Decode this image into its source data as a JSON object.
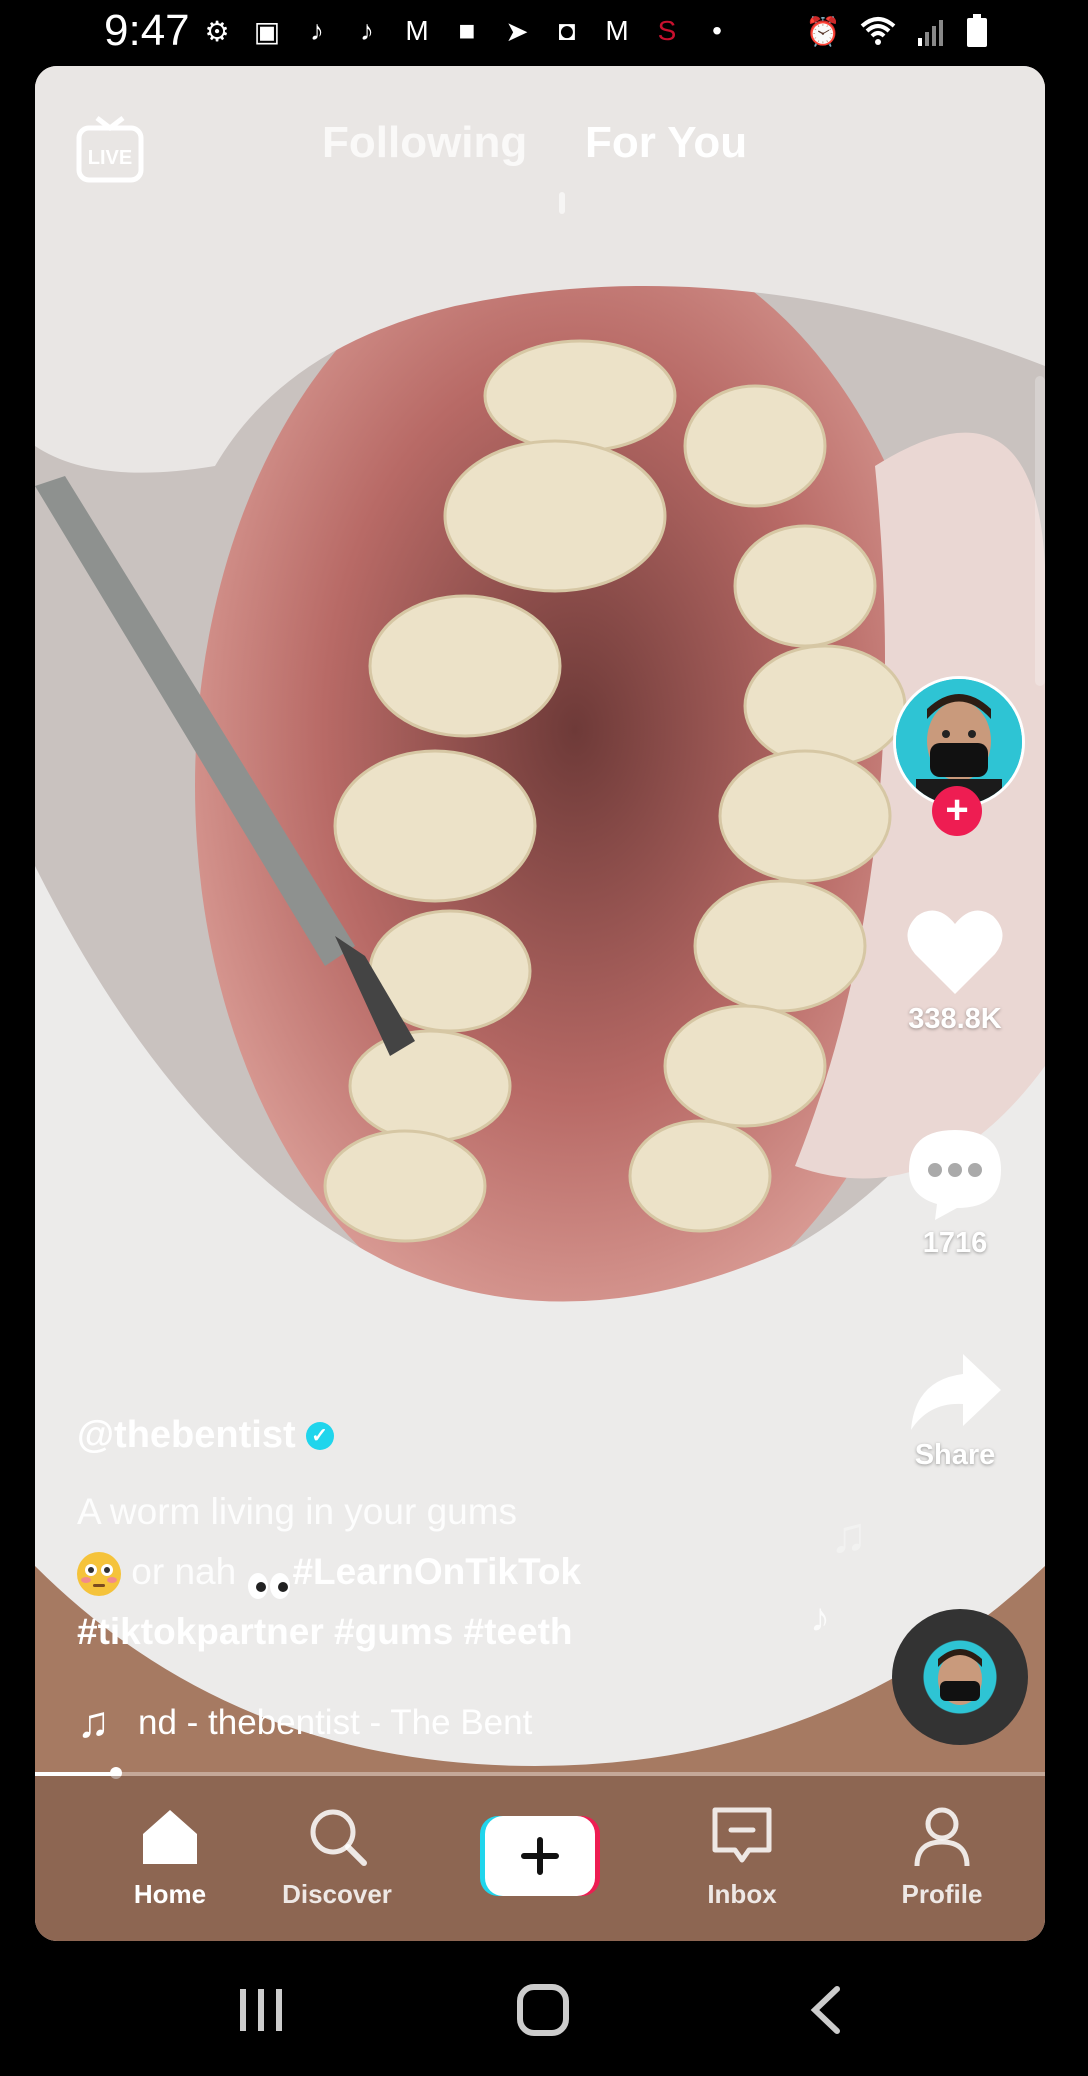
{
  "status_bar": {
    "time": "9:47"
  },
  "top_nav": {
    "live_label": "LIVE",
    "tabs": [
      {
        "label": "Following",
        "active": false
      },
      {
        "label": "For You",
        "active": true
      }
    ]
  },
  "rail": {
    "like_count": "338.8K",
    "comment_count": "1716",
    "share_label": "Share"
  },
  "post": {
    "username": "@thebentist",
    "caption_line1": "A worm living in your gums",
    "caption_or_nah": " or nah ",
    "caption_tag1": "#LearnOnTikTok",
    "caption_tags2": "#tiktokpartner #gums #teeth",
    "sound": "nd - thebentist - The Bent"
  },
  "progress": {
    "fraction": 0.08
  },
  "bottom_nav": {
    "items": [
      {
        "label": "Home",
        "icon": "home-icon",
        "active": true
      },
      {
        "label": "Discover",
        "icon": "search-icon",
        "active": false
      },
      {
        "label": "Inbox",
        "icon": "inbox-icon",
        "active": false
      },
      {
        "label": "Profile",
        "icon": "profile-icon",
        "active": false
      }
    ]
  },
  "colors": {
    "accent_pink": "#ee1d52",
    "accent_cyan": "#20d5ec"
  }
}
